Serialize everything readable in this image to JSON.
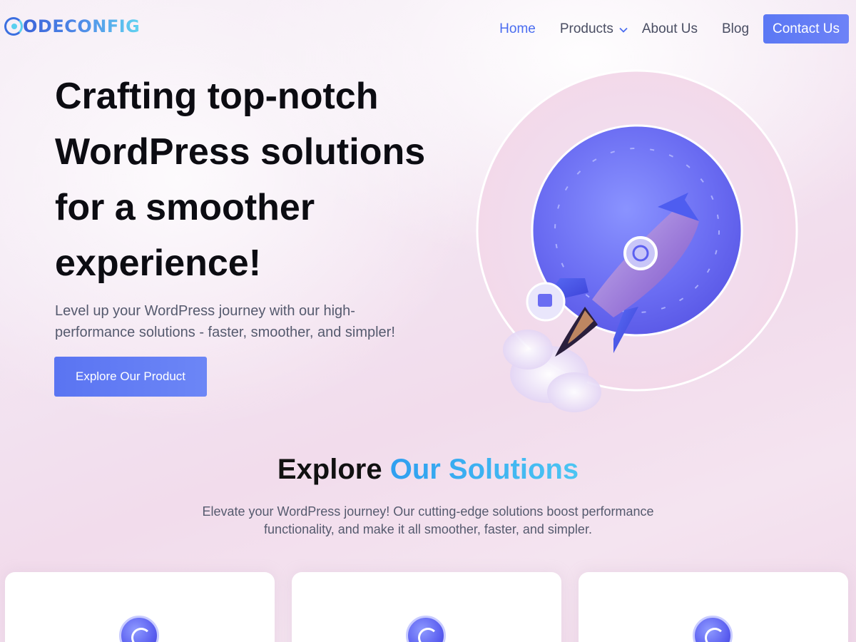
{
  "header": {
    "logo_text": "ODECONFIG",
    "nav": {
      "home": "Home",
      "products": "Products",
      "about": "About Us",
      "blog": "Blog",
      "contact": "Contact Us"
    }
  },
  "hero": {
    "title_lines": [
      "Crafting top-notch",
      "WordPress solutions",
      "for a smoother",
      "experience!"
    ],
    "subtitle_lines": [
      "Level up your WordPress journey with our high-",
      "performance solutions - faster, smoother, and simpler!"
    ],
    "cta": "Explore Our Product"
  },
  "solutions": {
    "title_plain": "Explore ",
    "title_accent": "Our Solutions",
    "subtitle_lines": [
      "Elevate your WordPress journey! Our cutting-edge solutions boost performance",
      "functionality, and make it all smoother, faster, and simpler."
    ],
    "card_count_visible": 3
  },
  "colors": {
    "accent": "#4a6cf0",
    "button": "#5b78f4",
    "solutions_accent": "#2f9ff0"
  }
}
